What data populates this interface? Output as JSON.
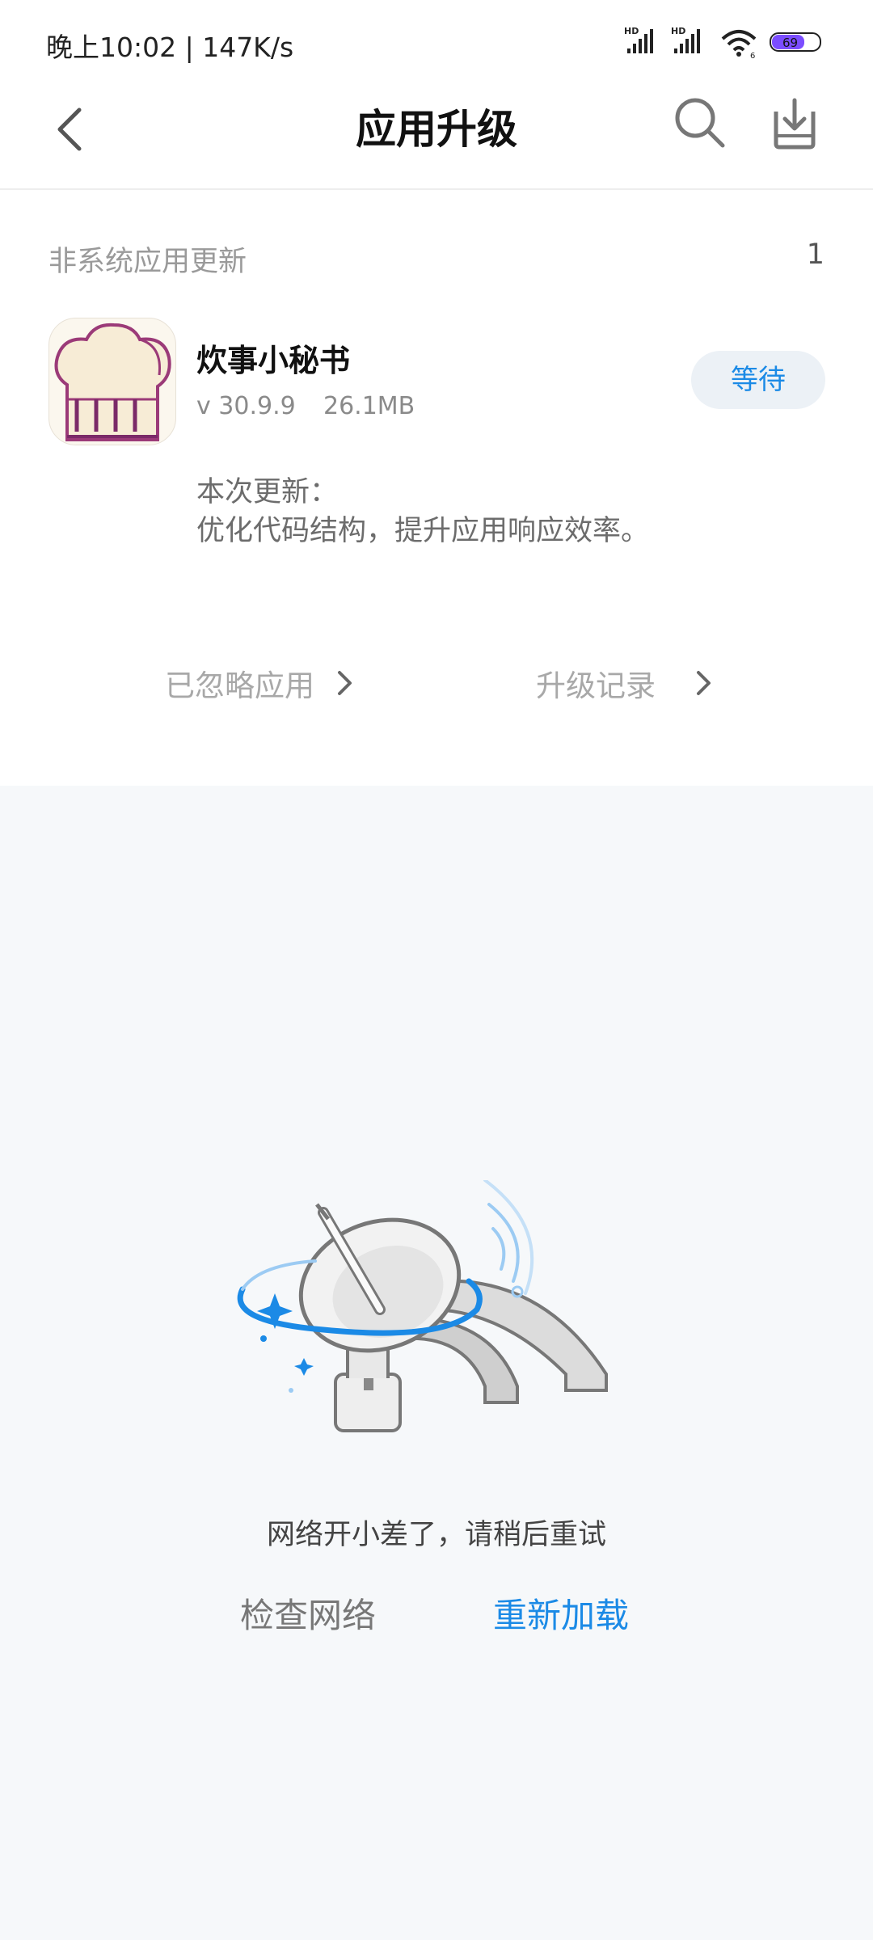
{
  "status_bar": {
    "time": "晚上10:02 | 147K/s",
    "signal1_label": "HD",
    "signal2_label": "HD",
    "wifi_label": "6",
    "battery": "69"
  },
  "header": {
    "title": "应用升级"
  },
  "section": {
    "title": "非系统应用更新",
    "count": "1"
  },
  "app": {
    "name": "炊事小秘书",
    "version": "v 30.9.9",
    "size": "26.1MB",
    "action_label": "等待",
    "update_title": "本次更新：",
    "update_text": "优化代码结构，提升应用响应效率。"
  },
  "links": {
    "ignored": "已忽略应用",
    "history": "升级记录"
  },
  "error": {
    "message": "网络开小差了，请稍后重试",
    "check_network": "检查网络",
    "reload": "重新加载"
  },
  "colors": {
    "accent": "#1b8ae6",
    "battery": "#7b4dff"
  },
  "icons": [
    "back-icon",
    "search-icon",
    "download-icon",
    "chevron-right-icon",
    "chef-hat-icon",
    "satellite-dish-icon",
    "wifi-icon",
    "signal-icon",
    "battery-icon"
  ]
}
